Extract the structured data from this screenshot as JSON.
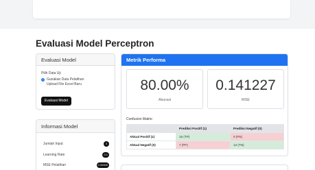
{
  "page_title": "Evaluasi Model Perceptron",
  "eval_card": {
    "title": "Evaluasi Model",
    "data_label": "Pilih Data Uji",
    "options": [
      {
        "label": "Gunakan Data Pelatihan",
        "selected": true
      },
      {
        "label": "Upload File Excel Baru",
        "selected": false
      }
    ],
    "button_label": "Evaluasi Model"
  },
  "info_card": {
    "title": "Informasi Model",
    "rows": [
      {
        "label": "Jumlah Input",
        "value": "3"
      },
      {
        "label": "Learning Rate",
        "value": "0.1"
      },
      {
        "label": "MSE Pelatihan",
        "value": "0.00000"
      }
    ]
  },
  "metrics_card": {
    "title": "Metrik Performa",
    "accuracy": {
      "value": "80.00%",
      "label": "Akurasi"
    },
    "mse": {
      "value": "0.141227",
      "label": "MSE"
    },
    "confusion_title": "Confusion Matrix:",
    "confusion": {
      "headers": [
        "",
        "Prediksi Positif (1)",
        "Prediksi Negatif (0)"
      ],
      "rows": [
        {
          "label": "Aktual Positif (1)",
          "cells": [
            "15 (TP)",
            "0 (FN)"
          ]
        },
        {
          "label": "Aktual Negatif (0)",
          "cells": [
            "7 (FP)",
            "13 (TN)"
          ]
        }
      ]
    }
  },
  "colors": {
    "accent": "#1f73f0",
    "false_cell": "#f6d0d3",
    "true_cell": "#d4ecd9"
  }
}
